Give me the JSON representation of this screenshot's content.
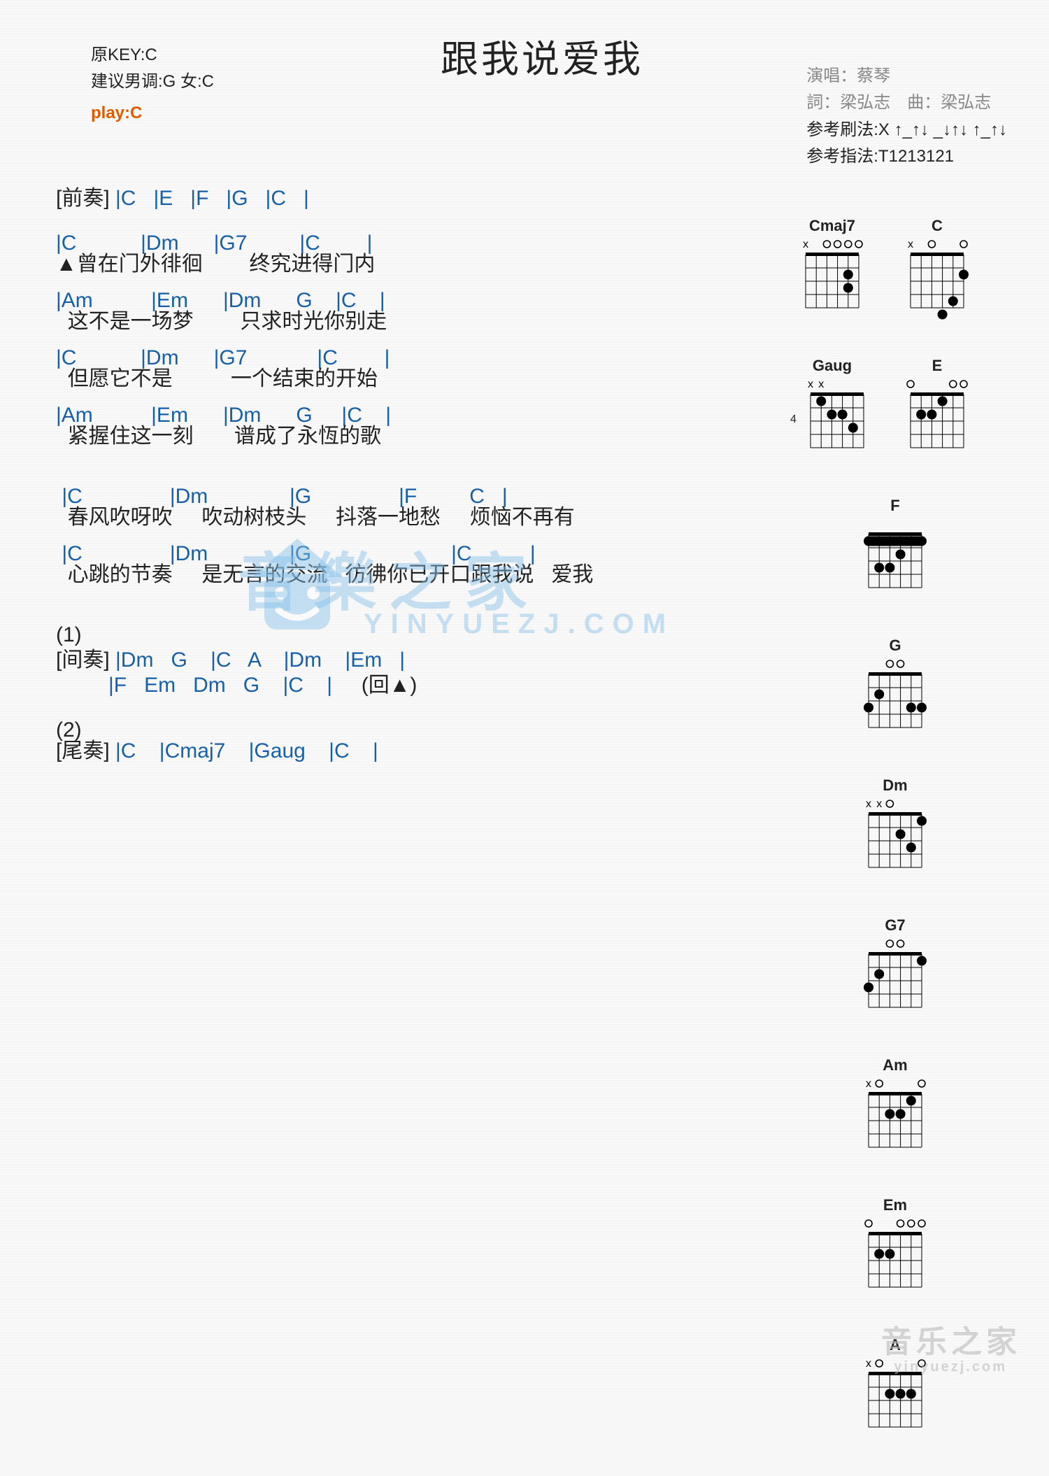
{
  "title": "跟我说爱我",
  "meta_left": {
    "orig_key": "原KEY:C",
    "suggest": "建议男调:G 女:C",
    "play": "play:C"
  },
  "meta_right": {
    "singer": "演唱：蔡琴",
    "credits": "詞：梁弘志　曲：梁弘志",
    "strum": "参考刷法:X ↑_↑↓ _↓↑↓ ↑_↑↓",
    "pick": "参考指法:T1213121"
  },
  "intro": {
    "label": "[前奏]",
    "chords": " |C   |E   |F   |G   |C   |"
  },
  "verse": [
    {
      "chords": "|C           |Dm      |G7         |C        |",
      "lyric": "▲曾在门外徘徊        终究进得门内"
    },
    {
      "chords": "|Am          |Em      |Dm      G    |C    |",
      "lyric": "  这不是一场梦        只求时光你别走"
    },
    {
      "chords": "|C           |Dm      |G7            |C        |",
      "lyric": "  但愿它不是          一个结束的开始"
    },
    {
      "chords": "|Am          |Em      |Dm      G     |C    |",
      "lyric": "  紧握住这一刻       谱成了永恆的歌"
    }
  ],
  "chorus": [
    {
      "chords": " |C               |Dm              |G               |F         C   |",
      "lyric": "  春风吹呀吹     吹动树枝头     抖落一地愁     烦恼不再有"
    },
    {
      "chords": " |C               |Dm              |G                        |C          |",
      "lyric": "  心跳的节奏     是无言的交流   彷彿你已开口跟我说   爱我"
    }
  ],
  "marker1": "(1)",
  "bridge": {
    "label": "[间奏]",
    "l1": " |Dm   G    |C   A    |Dm    |Em   |",
    "l2": "         |F   Em   Dm   G    |C    |     ",
    "loop": "(回▲)"
  },
  "marker2": "(2)",
  "outro": {
    "label": "[尾奏]",
    "chords": " |C    |Cmaj7    |Gaug    |C    |"
  },
  "chords_sidebar": [
    [
      "Cmaj7",
      "C"
    ],
    [
      "Gaug",
      "E"
    ],
    [
      "F"
    ],
    [
      "G"
    ],
    [
      "Dm"
    ],
    [
      "G7"
    ],
    [
      "Am"
    ],
    [
      "Em"
    ],
    [
      "A"
    ]
  ],
  "chord_data": {
    "Cmaj7": {
      "top": [
        "x",
        "",
        "o",
        "o",
        "o",
        "o"
      ],
      "dots": [
        [
          2,
          2
        ],
        [
          3,
          2
        ]
      ]
    },
    "C": {
      "top": [
        "x",
        "",
        "o",
        "",
        "",
        "o"
      ],
      "dots": [
        [
          2,
          1
        ],
        [
          4,
          2
        ],
        [
          5,
          3
        ]
      ]
    },
    "Gaug": {
      "top": [
        "x",
        "x",
        "",
        "",
        "",
        ""
      ],
      "fret": "4",
      "dots": [
        [
          1,
          5
        ],
        [
          2,
          4
        ],
        [
          2,
          3
        ],
        [
          3,
          2
        ]
      ]
    },
    "E": {
      "top": [
        "o",
        "",
        "",
        "",
        "o",
        "o"
      ],
      "dots": [
        [
          1,
          3
        ],
        [
          2,
          4
        ],
        [
          2,
          5
        ]
      ]
    },
    "F": {
      "top": [
        "",
        "",
        "",
        "",
        "",
        ""
      ],
      "barre": [
        1,
        1,
        6
      ],
      "dots": [
        [
          2,
          3
        ],
        [
          3,
          4
        ],
        [
          3,
          5
        ]
      ]
    },
    "G": {
      "top": [
        "",
        "",
        "o",
        "o",
        "",
        ""
      ],
      "dots": [
        [
          2,
          5
        ],
        [
          3,
          6
        ],
        [
          3,
          1
        ],
        [
          3,
          2
        ]
      ]
    },
    "Dm": {
      "top": [
        "x",
        "x",
        "o",
        "",
        "",
        ""
      ],
      "dots": [
        [
          1,
          1
        ],
        [
          2,
          3
        ],
        [
          3,
          2
        ]
      ]
    },
    "G7": {
      "top": [
        "",
        "",
        "o",
        "o",
        "",
        ""
      ],
      "dots": [
        [
          1,
          1
        ],
        [
          2,
          5
        ],
        [
          3,
          6
        ]
      ]
    },
    "Am": {
      "top": [
        "x",
        "o",
        "",
        "",
        "",
        "o"
      ],
      "dots": [
        [
          1,
          2
        ],
        [
          2,
          3
        ],
        [
          2,
          4
        ]
      ]
    },
    "Em": {
      "top": [
        "o",
        "",
        "",
        "o",
        "o",
        "o"
      ],
      "dots": [
        [
          2,
          4
        ],
        [
          2,
          5
        ]
      ]
    },
    "A": {
      "top": [
        "x",
        "o",
        "",
        "",
        "",
        "o"
      ],
      "dots": [
        [
          2,
          2
        ],
        [
          2,
          3
        ],
        [
          2,
          4
        ]
      ]
    }
  },
  "watermark": {
    "main": "音樂之家",
    "sub": "YINYUEZJ.COM"
  },
  "logo": {
    "main": "音乐之家",
    "sub": "yinyuezj.com"
  }
}
